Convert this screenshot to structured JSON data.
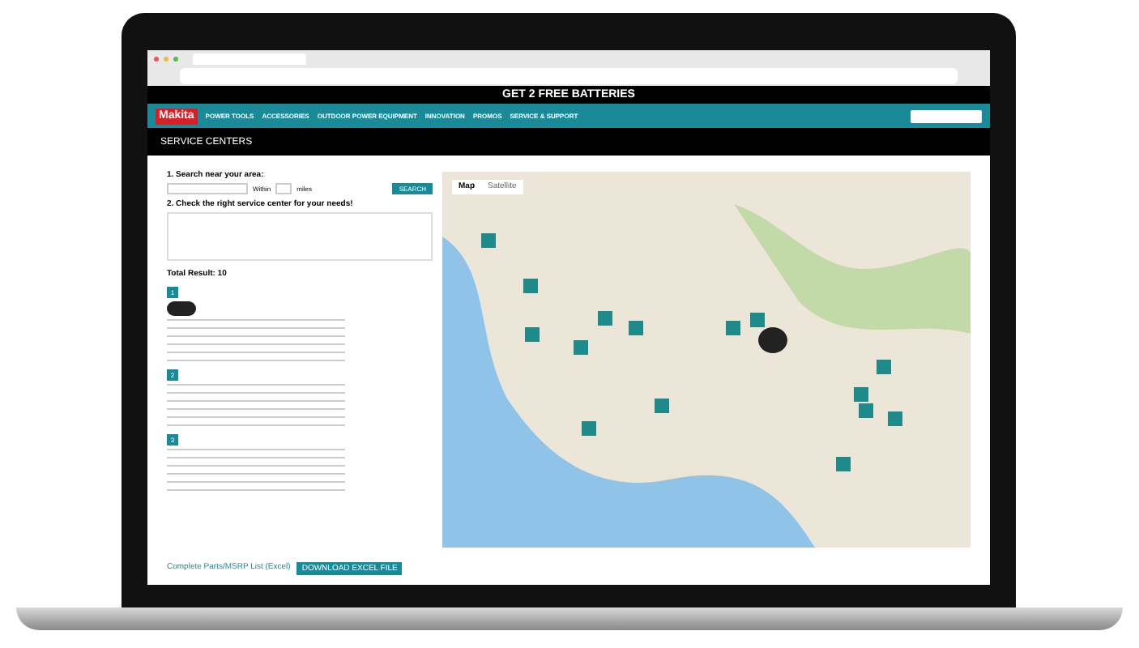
{
  "promo_bar": {
    "text": "GET 2 FREE BATTERIES"
  },
  "nav": {
    "logo": "Makita",
    "items": [
      {
        "label": "POWER TOOLS"
      },
      {
        "label": "ACCESSORIES"
      },
      {
        "label": "OUTDOOR POWER EQUIPMENT"
      },
      {
        "label": "INNOVATION"
      },
      {
        "label": "PROMOS"
      },
      {
        "label": "SERVICE & SUPPORT"
      }
    ]
  },
  "page_title": "SERVICE CENTERS",
  "search": {
    "step_1": "1. Search near your area:",
    "within": "Within",
    "miles": "miles",
    "button": "SEARCH",
    "step_2": "2. Check the right service center for your needs!"
  },
  "results": {
    "total": "Total Result: 10",
    "entries": [
      {
        "number": "1"
      },
      {
        "number": "2"
      },
      {
        "number": "3"
      }
    ]
  },
  "map": {
    "tabs": [
      {
        "label": "Map",
        "selected": true
      },
      {
        "label": "Satellite",
        "selected": false
      }
    ]
  },
  "footer": {
    "text": "Complete Parts/MSRP List (Excel)",
    "button": "DOWNLOAD EXCEL FILE"
  }
}
